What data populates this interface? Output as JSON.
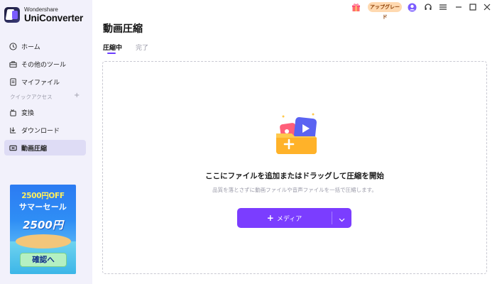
{
  "app": {
    "brand_sub": "Wondershare",
    "brand_name": "UniConverter"
  },
  "sidebar": {
    "items": [
      {
        "label": "ホーム",
        "icon": "home-icon"
      },
      {
        "label": "その他のツール",
        "icon": "toolbox-icon"
      },
      {
        "label": "マイファイル",
        "icon": "file-icon"
      }
    ],
    "quick_access_label": "クイックアクセス",
    "quick_add": "+",
    "quick_items": [
      {
        "label": "変換",
        "icon": "convert-icon"
      },
      {
        "label": "ダウンロード",
        "icon": "download-icon"
      },
      {
        "label": "動画圧縮",
        "icon": "compress-icon",
        "active": true
      }
    ]
  },
  "banner": {
    "line1": "2500円OFF",
    "line2": "サマーセール",
    "price": "2500円",
    "button": "確認へ"
  },
  "titlebar": {
    "upgrade_label": "アップグレード",
    "icons": [
      "gift-icon",
      "avatar-icon",
      "headset-icon",
      "menu-icon",
      "minimize-icon",
      "maximize-icon",
      "close-icon"
    ]
  },
  "main": {
    "title": "動画圧縮",
    "tabs": [
      {
        "label": "圧縮中",
        "active": true
      },
      {
        "label": "完了",
        "active": false
      }
    ],
    "drop_title": "ここにファイルを追加またはドラッグして圧縮を開始",
    "drop_sub": "品質を落とさずに動画ファイルや音声ファイルを一括で圧縮します。",
    "media_button": "メディア",
    "media_plus": "+"
  },
  "colors": {
    "accent": "#7b3dff",
    "sidebar_bg": "#f2f1fb",
    "active_item_bg": "#dedcf5",
    "upgrade_bg": "#ffd9b0"
  }
}
